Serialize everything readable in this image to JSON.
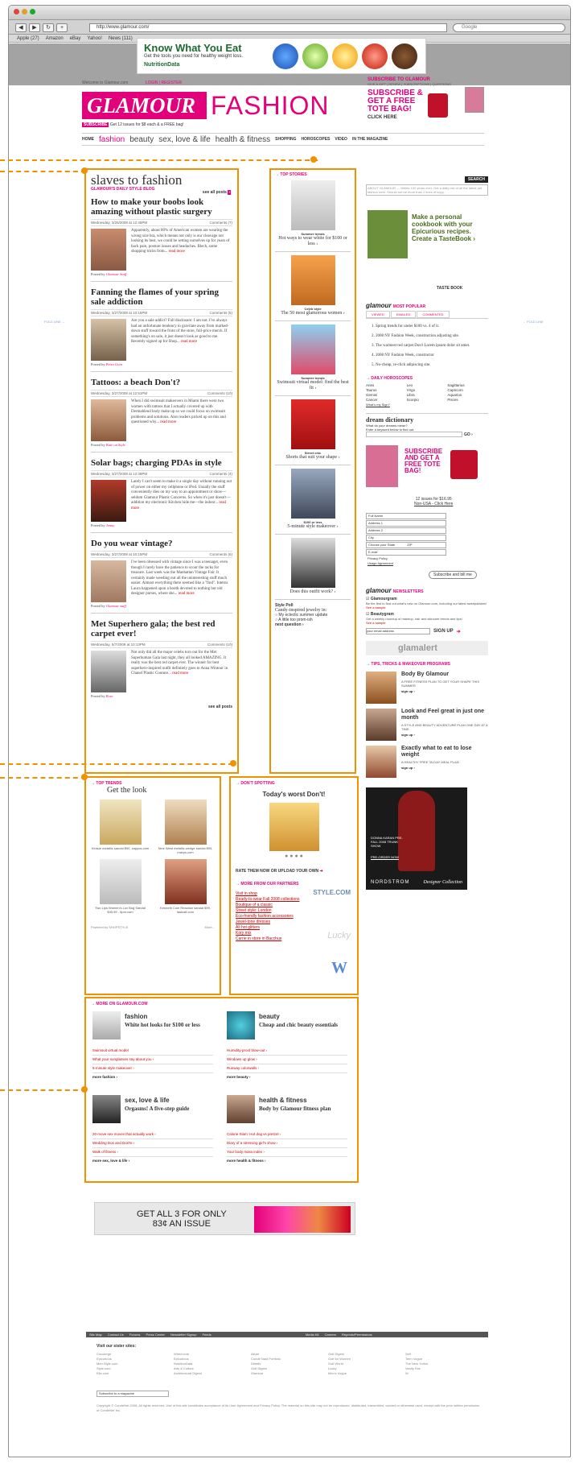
{
  "browser": {
    "url": "http://www.glamour.com/",
    "search_placeholder": "Google",
    "bookmarks": [
      "Apple (27)",
      "Amazon",
      "eBay",
      "Yahoo!",
      "News (111)"
    ]
  },
  "ad": {
    "title": "Know What You Eat",
    "subtitle": "Get the tools you need for healthy weight loss.",
    "brand": "NutritionData"
  },
  "header": {
    "welcome": "Welcome to Glamour.com",
    "login": "LOGIN | REGISTER",
    "logo": "GLAMOUR",
    "section": "FASHION",
    "subscribe_tag": "SUBSCRIBE",
    "subscribe_text": "Get 12 issues for $8 each & a FREE bag!",
    "promo_head": "SUBSCRIBE TO GLAMOUR",
    "promo_links": "GIVE A GIFT | RENEW | SUBSCRIPTIONS | QUESTIONS",
    "promo_text": "SUBSCRIBE & GET A FREE TOTE BAG!",
    "promo_click": "CLICK HERE"
  },
  "nav": {
    "home": "HOME",
    "fashion": "fashion",
    "beauty": "beauty",
    "sex": "sex, love & life",
    "health": "health & fitness",
    "shopping": "SHOPPING",
    "horoscopes": "HOROSCOPES",
    "video": "VIDEO",
    "magazine": "IN THE MAGAZINE"
  },
  "fold": {
    "left": "FOLD LINE →",
    "right": "← FOLD LINE"
  },
  "blog": {
    "title": "slaves to fashion",
    "subtitle": "GLAMOUR'S DAILY STYLE BLOG",
    "see_all": "see all posts",
    "see_all_bottom": "see all posts",
    "posts": [
      {
        "title": "How to make your boobs look amazing without plastic surgery",
        "date": "Wednesday, 3/25/2008 at 12:45PM",
        "comments": "Comments (7)",
        "body": "Apparently, about 80% of American women are wearing the wrong size bra, which means not only is our cleavage not looking its best, we could be setting ourselves up for years of back pain, posture issues and headaches. Blech, some shopping tricks from...",
        "more": "read more",
        "by": "Posted by",
        "author": "Glamour Staff"
      },
      {
        "title": "Fanning the flames of your spring sale addiction",
        "date": "Wednesday, 3/27/2008 at 10:15PM",
        "comments": "Comments (5)",
        "body": "Are you a sale addict? Full disclosure: I am not. I've always had an unfortunate tendency to gravitate away from marked-down stuff toward the front of the store, full-price merch. If something's on sale, it just doesn't look as good to me. Recently signed up for Shop...",
        "more": "read more",
        "by": "Posted by",
        "author": "Petra Goin"
      },
      {
        "title": "Tattoos: a beach Don't?",
        "date": "Wednesday, 3/27/2008 at 12:51PM",
        "comments": "Comments (10)",
        "body": "When I did swimsuit makeovers in Miami there were two women with tattoos that I actually covered up with Dermablend body make up so we could focus on swimsuit problems and solutions. Also readers picked up on this and questioned why...",
        "more": "read more",
        "by": "Posted by",
        "author": "Kate on Style"
      },
      {
        "title": "Solar bags; charging PDAs in style",
        "date": "Wednesday, 3/27/2008 at 12:38PM",
        "comments": "Comments (4)",
        "body": "Lately I can't seem to make it a single day without running out of power on either my cellphone or iPod. Usually the stuff conveniently dies on my way to an appointment or show—seldom Glamour Plastic Concerns. So when it's just doesn't—addition my electronic Kitchen hide me—the indoor...",
        "more": "read more",
        "by": "Posted by",
        "author": "Jenny"
      },
      {
        "title": "Do you wear vintage?",
        "date": "Wednesday, 3/27/2008 at 10:15PM",
        "comments": "Comments (6)",
        "body": "I've been obsessed with vintage since I was a teenager, even though I rarely have the patience to scour the racks for treasure. Last week was the Manhattan Vintage Fair. It certainly made weeding out all the uninteresting stuff much easier. Almost everything there seemed like a \"find\". Interns Laura happened upon a booth devoted to nothing but old designer purses, where she...",
        "more": "read more",
        "by": "Posted by",
        "author": "Glamour staff"
      },
      {
        "title": "Met Superhero gala; the best red carpet ever!",
        "date": "Wednesday, 5/7/2008 at 10:13PM",
        "comments": "Comments (10)",
        "body": "Not only did all the major celebs turn out for the Met Superhuman Gala last night, they all looked AMAZING. It really was the best red carpet ever. The winner for best superhero-inspired outfit definitely goes to Anna Wintour in Chanel Plastic Couture...",
        "more": "read more",
        "by": "Posted by",
        "author": "Rose"
      }
    ]
  },
  "stories": {
    "head": "TOP STORIES",
    "items": [
      {
        "cap": "Summer trends",
        "title": "Hot ways to wear white for $100 or less ›"
      },
      {
        "cap": "Celeb style",
        "title": "The 50 most glamorous women ›"
      },
      {
        "cap": "Summer trends",
        "title": "Swimsuit virtual model: find the best fit ›"
      },
      {
        "cap": "Street chic",
        "title": "Shorts that suit your shape ›"
      },
      {
        "cap": "$100 or less",
        "title": "5-minute style makeover ›"
      },
      {
        "cap": "",
        "title": "Does this outfit work? ›"
      }
    ],
    "poll_head": "Style Poll",
    "poll_q": "Candy-inspired jewelry in:",
    "poll_a": "My eclectic summer update",
    "poll_b": "A little too prom-ish",
    "poll_next": "next question ›"
  },
  "right": {
    "search_label": "SEARCH",
    "search_hint": "ABOUT GLAMOUR — Writes 100 years ever. Get a daily mix of all the latest pet fashion here. Should not be more than 2 lines of copy.",
    "epi_text": "Make a personal cookbook with your Epicurious recipes. Create a TasteBook ›",
    "epi_logo": "TASTE BOOK",
    "mp_brand": "glamour",
    "mp_head": "MOST POPULAR",
    "mp_tabs": [
      "VIEWED",
      "EMAILED",
      "COMMENTED"
    ],
    "mp_items": [
      "Spring trends for under $100 vs. 4 of it.",
      "2008 NY Fashion Week, construction adjusting site.",
      "The warmest red carpet Don't Lorem ipsum dolor sit amet.",
      "2008 NY Fashion Week, constructor",
      "No-cheap, re-click adipiscing site."
    ],
    "horo_head": "DAILY HOROSCOPES",
    "signs": [
      "Aries",
      "Leo",
      "Sagittarius",
      "Taurus",
      "Virgo",
      "Capricorn",
      "Gemini",
      "Libra",
      "Aquarius",
      "Cancer",
      "Scorpio",
      "Pisces"
    ],
    "whats_sign": "What's my Sign?",
    "dd_title": "dream dictionary",
    "dd_q": "What do your dreams mean?",
    "dd_hint": "Enter a keyword below to find out.",
    "dd_go": "GO ›",
    "sub_text": "SUBSCRIBE AND GET A FREE TOTE BAG!",
    "sub_price": "12 issues for $16.95",
    "sub_link": "Non-USA - Click Here",
    "sub_fields": [
      "Full Name",
      "Address 1",
      "Address 2",
      "City",
      "Choose your State",
      "E-mail"
    ],
    "sub_zip": "ZIP",
    "sub_privacy": "Privacy Policy",
    "sub_ua": "Usage Agreement",
    "sub_btn": "Subscribe and bill me",
    "nl_brand": "glamour",
    "nl_head": "NEWSLETTERS",
    "nl1": "Glamourgram",
    "nl1d": "Be the first to find out what's new on Glamour.com, including our latest sweepstakes!",
    "nl1s": "See a sample",
    "nl2": "Beautygram",
    "nl2d": "Get a weekly roundup of makeup, hair and skincare trends and tips!",
    "nl2s": "See a sample",
    "email_ph": "your email address",
    "signup": "SIGN UP",
    "glamalert": "glamalert",
    "tips_head": "TIPS, TRICKS & MAKEOVER PROGRAMS",
    "tips": [
      {
        "t": "Body By Glamour",
        "d": "A FREE FITNESS PLAN TO GET YOUR SHAPE THIS SUMMER",
        "s": "sign up ›"
      },
      {
        "t": "Look and Feel great in just one month",
        "d": "A STYLE AND BEAUTY ADVENTURE PLAN ONE DAY AT A TIME",
        "s": "sign up ›"
      },
      {
        "t": "Exactly what to eat to lose weight",
        "d": "A HEALTHY FREE 30-DAY MEAL PLAN",
        "s": "sign up ›"
      }
    ],
    "nord_text": "DONNA KARAN PRE-FALL 2008 TRUNK SHOW",
    "nord_link": "PRE-ORDER NOW",
    "nord_brand": "NORDSTROM",
    "nord_script": "Designer Collection"
  },
  "trends": {
    "head": "TOP TRENDS",
    "title": "Get the look",
    "items": [
      {
        "c": "Kensie metallic sandal $90, zappos.com"
      },
      {
        "c": "Nine West metallic wedge sandal $90, macys.com"
      },
      {
        "c": "Two Lips Women's Lux Bug Sandal $45.99 - 6pm.com"
      },
      {
        "c": "Kenneth Cole Reaction sandal $99, lastcall.com"
      }
    ],
    "powered": "Powered by SHOPSTYLE",
    "more": "More..."
  },
  "dont": {
    "head": "DON'T SPOTTING",
    "title": "Today's worst Don't!",
    "rate": "RATE THEM NOW OR UPLOAD YOUR OWN",
    "partners_head": "MORE FROM OUR PARTNERS",
    "links": [
      "Visit in shop",
      "Ready-to-wear Fall 2008 collections",
      "Boutique of a classic",
      "Street style: London",
      "Eco-friendly fashion accessories",
      "Jewel-tone dresses",
      "All hot glitters",
      "Kory mix",
      "Carrie in store in Bacchus"
    ],
    "style": "STYLE.COM",
    "lucky": "Lucky",
    "w": "W"
  },
  "moreon": {
    "head": "MORE ON GLAMOUR.COM",
    "fashion": {
      "cat": "fashion",
      "title": "White hot looks for $100 or less",
      "links": [
        "Swimsuit virtual model",
        "What your sunglasses say about you ›",
        "5-minute style makeover ›"
      ],
      "more": "more fashion ›"
    },
    "beauty": {
      "cat": "beauty",
      "title": "Cheap and chic beauty essentials",
      "links": [
        "Humidity-proof blow-out ›",
        "Windows up glow ›",
        "Runway colorwalls ›"
      ],
      "more": "more beauty ›"
    },
    "sex": {
      "cat": "sex, love & life",
      "title": "Orgasms! A five-step guide",
      "links": [
        "20 move sex moves that actually work ›",
        "Wedding Dos and Don'ts ›",
        "Walk of fitness ›"
      ],
      "more": "more sex, love & life ›"
    },
    "health": {
      "cat": "health & fitness",
      "title": "Body by Glamour fitness plan",
      "links": [
        "Calorie Slam: Hot dog vs pretzel ›",
        "Diary of a stressing girl's show ›",
        "Your body mass index ›"
      ],
      "more": "more health & fitness ›"
    }
  },
  "get3": {
    "text1": "GET ALL 3 FOR ONLY",
    "text2": "83¢ AN ISSUE"
  },
  "footer": {
    "links": [
      "Site Map",
      "Contact Us",
      "Forums",
      "Press Center",
      "Newsletter Signup",
      "Feeds",
      "Media Kit",
      "Careers",
      "Reprints/Permissions"
    ],
    "sister_head": "Visit our sister sites:",
    "cols": [
      [
        "Concierge",
        "Epicurious",
        "Men.Style.com",
        "Style.com",
        "Elle.com"
      ],
      [
        "Wired.com",
        "Epicurious",
        "NutritionData",
        "Arts & Culture",
        "Architectural Digest"
      ],
      [
        "Allure",
        "Condé Nast Portfolio",
        "Details",
        "Golf Digest",
        "Glamour"
      ],
      [
        "Golf Digest",
        "Golf for Women",
        "Golf World",
        "Lucky",
        "Men's Vogue"
      ],
      [
        "Self",
        "Teen Vogue",
        "The New Yorker",
        "Vanity Fair",
        "W"
      ]
    ],
    "select": "Subscribe to a magazine",
    "copyright": "Copyright © CondéNet 2008. All rights reserved. Use of this site constitutes acceptance of its User Agreement and Privacy Policy. The material on this site may not be reproduced, distributed, transmitted, cached or otherwise used, except with the prior written permission of CondéNet Inc."
  },
  "colors": {
    "brand": "#e3007b",
    "highlight": "#f29100"
  }
}
